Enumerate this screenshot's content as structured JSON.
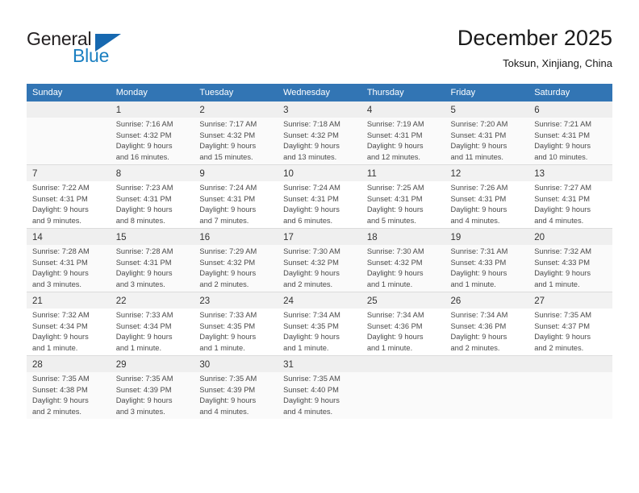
{
  "logo": {
    "word_top": "General",
    "word_bottom": "Blue"
  },
  "header": {
    "title": "December 2025",
    "subtitle": "Toksun, Xinjiang, China"
  },
  "calendar": {
    "weekday_headers": [
      "Sunday",
      "Monday",
      "Tuesday",
      "Wednesday",
      "Thursday",
      "Friday",
      "Saturday"
    ],
    "weeks": [
      [
        {
          "day": "",
          "lines": []
        },
        {
          "day": "1",
          "lines": [
            "Sunrise: 7:16 AM",
            "Sunset: 4:32 PM",
            "Daylight: 9 hours",
            "and 16 minutes."
          ]
        },
        {
          "day": "2",
          "lines": [
            "Sunrise: 7:17 AM",
            "Sunset: 4:32 PM",
            "Daylight: 9 hours",
            "and 15 minutes."
          ]
        },
        {
          "day": "3",
          "lines": [
            "Sunrise: 7:18 AM",
            "Sunset: 4:32 PM",
            "Daylight: 9 hours",
            "and 13 minutes."
          ]
        },
        {
          "day": "4",
          "lines": [
            "Sunrise: 7:19 AM",
            "Sunset: 4:31 PM",
            "Daylight: 9 hours",
            "and 12 minutes."
          ]
        },
        {
          "day": "5",
          "lines": [
            "Sunrise: 7:20 AM",
            "Sunset: 4:31 PM",
            "Daylight: 9 hours",
            "and 11 minutes."
          ]
        },
        {
          "day": "6",
          "lines": [
            "Sunrise: 7:21 AM",
            "Sunset: 4:31 PM",
            "Daylight: 9 hours",
            "and 10 minutes."
          ]
        }
      ],
      [
        {
          "day": "7",
          "lines": [
            "Sunrise: 7:22 AM",
            "Sunset: 4:31 PM",
            "Daylight: 9 hours",
            "and 9 minutes."
          ]
        },
        {
          "day": "8",
          "lines": [
            "Sunrise: 7:23 AM",
            "Sunset: 4:31 PM",
            "Daylight: 9 hours",
            "and 8 minutes."
          ]
        },
        {
          "day": "9",
          "lines": [
            "Sunrise: 7:24 AM",
            "Sunset: 4:31 PM",
            "Daylight: 9 hours",
            "and 7 minutes."
          ]
        },
        {
          "day": "10",
          "lines": [
            "Sunrise: 7:24 AM",
            "Sunset: 4:31 PM",
            "Daylight: 9 hours",
            "and 6 minutes."
          ]
        },
        {
          "day": "11",
          "lines": [
            "Sunrise: 7:25 AM",
            "Sunset: 4:31 PM",
            "Daylight: 9 hours",
            "and 5 minutes."
          ]
        },
        {
          "day": "12",
          "lines": [
            "Sunrise: 7:26 AM",
            "Sunset: 4:31 PM",
            "Daylight: 9 hours",
            "and 4 minutes."
          ]
        },
        {
          "day": "13",
          "lines": [
            "Sunrise: 7:27 AM",
            "Sunset: 4:31 PM",
            "Daylight: 9 hours",
            "and 4 minutes."
          ]
        }
      ],
      [
        {
          "day": "14",
          "lines": [
            "Sunrise: 7:28 AM",
            "Sunset: 4:31 PM",
            "Daylight: 9 hours",
            "and 3 minutes."
          ]
        },
        {
          "day": "15",
          "lines": [
            "Sunrise: 7:28 AM",
            "Sunset: 4:31 PM",
            "Daylight: 9 hours",
            "and 3 minutes."
          ]
        },
        {
          "day": "16",
          "lines": [
            "Sunrise: 7:29 AM",
            "Sunset: 4:32 PM",
            "Daylight: 9 hours",
            "and 2 minutes."
          ]
        },
        {
          "day": "17",
          "lines": [
            "Sunrise: 7:30 AM",
            "Sunset: 4:32 PM",
            "Daylight: 9 hours",
            "and 2 minutes."
          ]
        },
        {
          "day": "18",
          "lines": [
            "Sunrise: 7:30 AM",
            "Sunset: 4:32 PM",
            "Daylight: 9 hours",
            "and 1 minute."
          ]
        },
        {
          "day": "19",
          "lines": [
            "Sunrise: 7:31 AM",
            "Sunset: 4:33 PM",
            "Daylight: 9 hours",
            "and 1 minute."
          ]
        },
        {
          "day": "20",
          "lines": [
            "Sunrise: 7:32 AM",
            "Sunset: 4:33 PM",
            "Daylight: 9 hours",
            "and 1 minute."
          ]
        }
      ],
      [
        {
          "day": "21",
          "lines": [
            "Sunrise: 7:32 AM",
            "Sunset: 4:34 PM",
            "Daylight: 9 hours",
            "and 1 minute."
          ]
        },
        {
          "day": "22",
          "lines": [
            "Sunrise: 7:33 AM",
            "Sunset: 4:34 PM",
            "Daylight: 9 hours",
            "and 1 minute."
          ]
        },
        {
          "day": "23",
          "lines": [
            "Sunrise: 7:33 AM",
            "Sunset: 4:35 PM",
            "Daylight: 9 hours",
            "and 1 minute."
          ]
        },
        {
          "day": "24",
          "lines": [
            "Sunrise: 7:34 AM",
            "Sunset: 4:35 PM",
            "Daylight: 9 hours",
            "and 1 minute."
          ]
        },
        {
          "day": "25",
          "lines": [
            "Sunrise: 7:34 AM",
            "Sunset: 4:36 PM",
            "Daylight: 9 hours",
            "and 1 minute."
          ]
        },
        {
          "day": "26",
          "lines": [
            "Sunrise: 7:34 AM",
            "Sunset: 4:36 PM",
            "Daylight: 9 hours",
            "and 2 minutes."
          ]
        },
        {
          "day": "27",
          "lines": [
            "Sunrise: 7:35 AM",
            "Sunset: 4:37 PM",
            "Daylight: 9 hours",
            "and 2 minutes."
          ]
        }
      ],
      [
        {
          "day": "28",
          "lines": [
            "Sunrise: 7:35 AM",
            "Sunset: 4:38 PM",
            "Daylight: 9 hours",
            "and 2 minutes."
          ]
        },
        {
          "day": "29",
          "lines": [
            "Sunrise: 7:35 AM",
            "Sunset: 4:39 PM",
            "Daylight: 9 hours",
            "and 3 minutes."
          ]
        },
        {
          "day": "30",
          "lines": [
            "Sunrise: 7:35 AM",
            "Sunset: 4:39 PM",
            "Daylight: 9 hours",
            "and 4 minutes."
          ]
        },
        {
          "day": "31",
          "lines": [
            "Sunrise: 7:35 AM",
            "Sunset: 4:40 PM",
            "Daylight: 9 hours",
            "and 4 minutes."
          ]
        },
        {
          "day": "",
          "lines": []
        },
        {
          "day": "",
          "lines": []
        },
        {
          "day": "",
          "lines": []
        }
      ]
    ]
  },
  "colors": {
    "header_blue": "#3275b4",
    "logo_blue": "#1668b0",
    "day_shade": "#f2f2f2"
  }
}
